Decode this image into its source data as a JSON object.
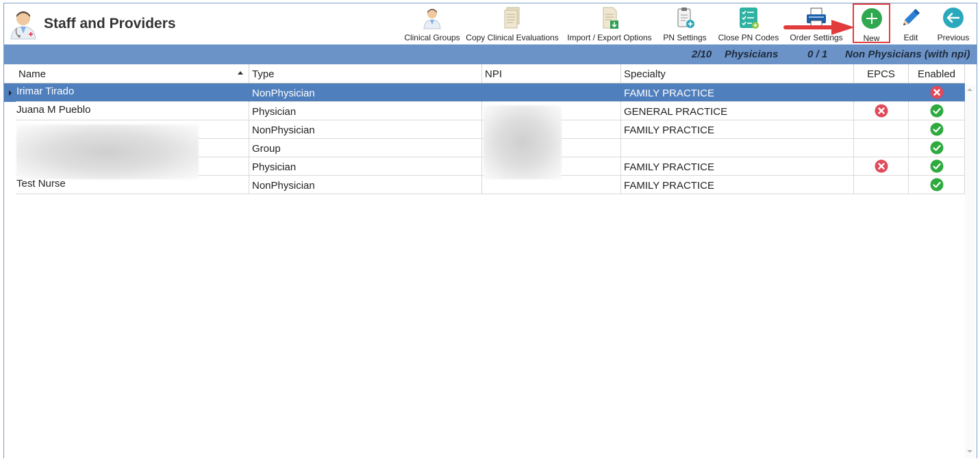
{
  "header": {
    "title": "Staff and Providers",
    "logo_icon": "staff-doctor-icon"
  },
  "toolbar": {
    "items": [
      {
        "label": "Clinical Groups",
        "icon": "clinical-groups-icon"
      },
      {
        "label": "Copy Clinical Evaluations",
        "icon": "copy-document-icon"
      },
      {
        "label": "Import / Export Options",
        "icon": "import-export-icon"
      },
      {
        "label": "PN Settings",
        "icon": "pn-settings-icon"
      },
      {
        "label": "Close PN Codes",
        "icon": "checklist-icon"
      },
      {
        "label": "Order Settings",
        "icon": "printer-icon"
      },
      {
        "label": "New",
        "icon": "plus-circle-icon",
        "highlighted": true
      },
      {
        "label": "Edit",
        "icon": "pencil-icon"
      },
      {
        "label": "Previous",
        "icon": "arrow-left-circle-icon"
      }
    ]
  },
  "summary": {
    "physicians_count": "2/10",
    "physicians_label": "Physicians",
    "non_physicians_count": "0 / 1",
    "non_physicians_label": "Non Physicians (with npi)"
  },
  "grid": {
    "columns": [
      "Name",
      "Type",
      "NPI",
      "Specialty",
      "EPCS",
      "Enabled"
    ],
    "sort_column": "Name",
    "rows": [
      {
        "name": "Irimar Tirado",
        "type": "NonPhysician",
        "npi": "",
        "specialty": "FAMILY PRACTICE",
        "epcs": "",
        "enabled": "no",
        "selected": true
      },
      {
        "name": "Juana M Pueblo",
        "type": "Physician",
        "npi": "",
        "specialty": "GENERAL PRACTICE",
        "epcs": "no",
        "enabled": "yes"
      },
      {
        "name": "",
        "type": "NonPhysician",
        "npi": "",
        "specialty": "FAMILY PRACTICE",
        "epcs": "",
        "enabled": "yes"
      },
      {
        "name": "",
        "type": "Group",
        "npi": "",
        "specialty": "",
        "epcs": "",
        "enabled": "yes"
      },
      {
        "name": "",
        "type": "Physician",
        "npi": "",
        "specialty": "FAMILY PRACTICE",
        "epcs": "no",
        "enabled": "yes"
      },
      {
        "name": "Test Nurse",
        "type": "NonPhysician",
        "npi": "",
        "specialty": "FAMILY PRACTICE",
        "epcs": "",
        "enabled": "yes"
      }
    ]
  },
  "colors": {
    "summary_bar": "#6b93c8",
    "selected_row": "#4f7fbd",
    "enabled_yes": "#2eaa3f",
    "enabled_no": "#e04a5a",
    "highlight_border": "#e23b3b"
  }
}
